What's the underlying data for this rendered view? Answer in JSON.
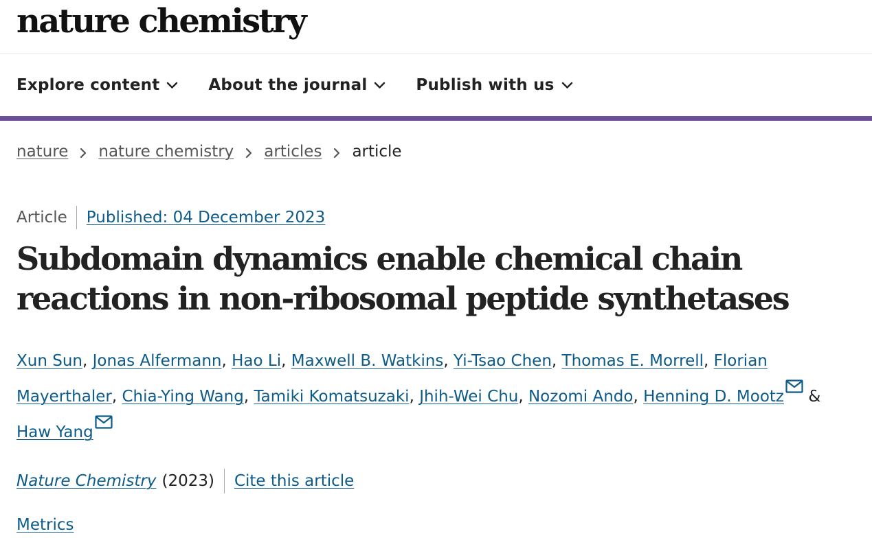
{
  "header": {
    "logo_text": "nature chemistry"
  },
  "nav": {
    "items": [
      {
        "label": "Explore content"
      },
      {
        "label": "About the journal"
      },
      {
        "label": "Publish with us"
      }
    ],
    "accent_color": "#6d4e99"
  },
  "breadcrumb": {
    "items": [
      {
        "label": "nature"
      },
      {
        "label": "nature chemistry"
      },
      {
        "label": "articles"
      }
    ],
    "current": "article"
  },
  "article": {
    "type": "Article",
    "published": "Published: 04 December 2023",
    "title": "Subdomain dynamics enable chemical chain reactions in non-ribosomal peptide synthetases",
    "authors": [
      "Xun Sun",
      "Jonas Alfermann",
      "Hao Li",
      "Maxwell B. Watkins",
      "Yi-Tsao Chen",
      "Thomas E. Morrell",
      "Florian Mayerthaler",
      "Chia-Ying Wang",
      "Tamiki Komatsuzaki",
      "Jhih-Wei Chu",
      "Nozomi Ando",
      "Henning D. Mootz",
      "Haw Yang"
    ],
    "separator_comma": ",",
    "separator_and": "&",
    "journal": "Nature Chemistry",
    "year": "(2023)",
    "cite_label": "Cite this article",
    "metrics_label": "Metrics",
    "link_color": "#0c5b8a"
  }
}
